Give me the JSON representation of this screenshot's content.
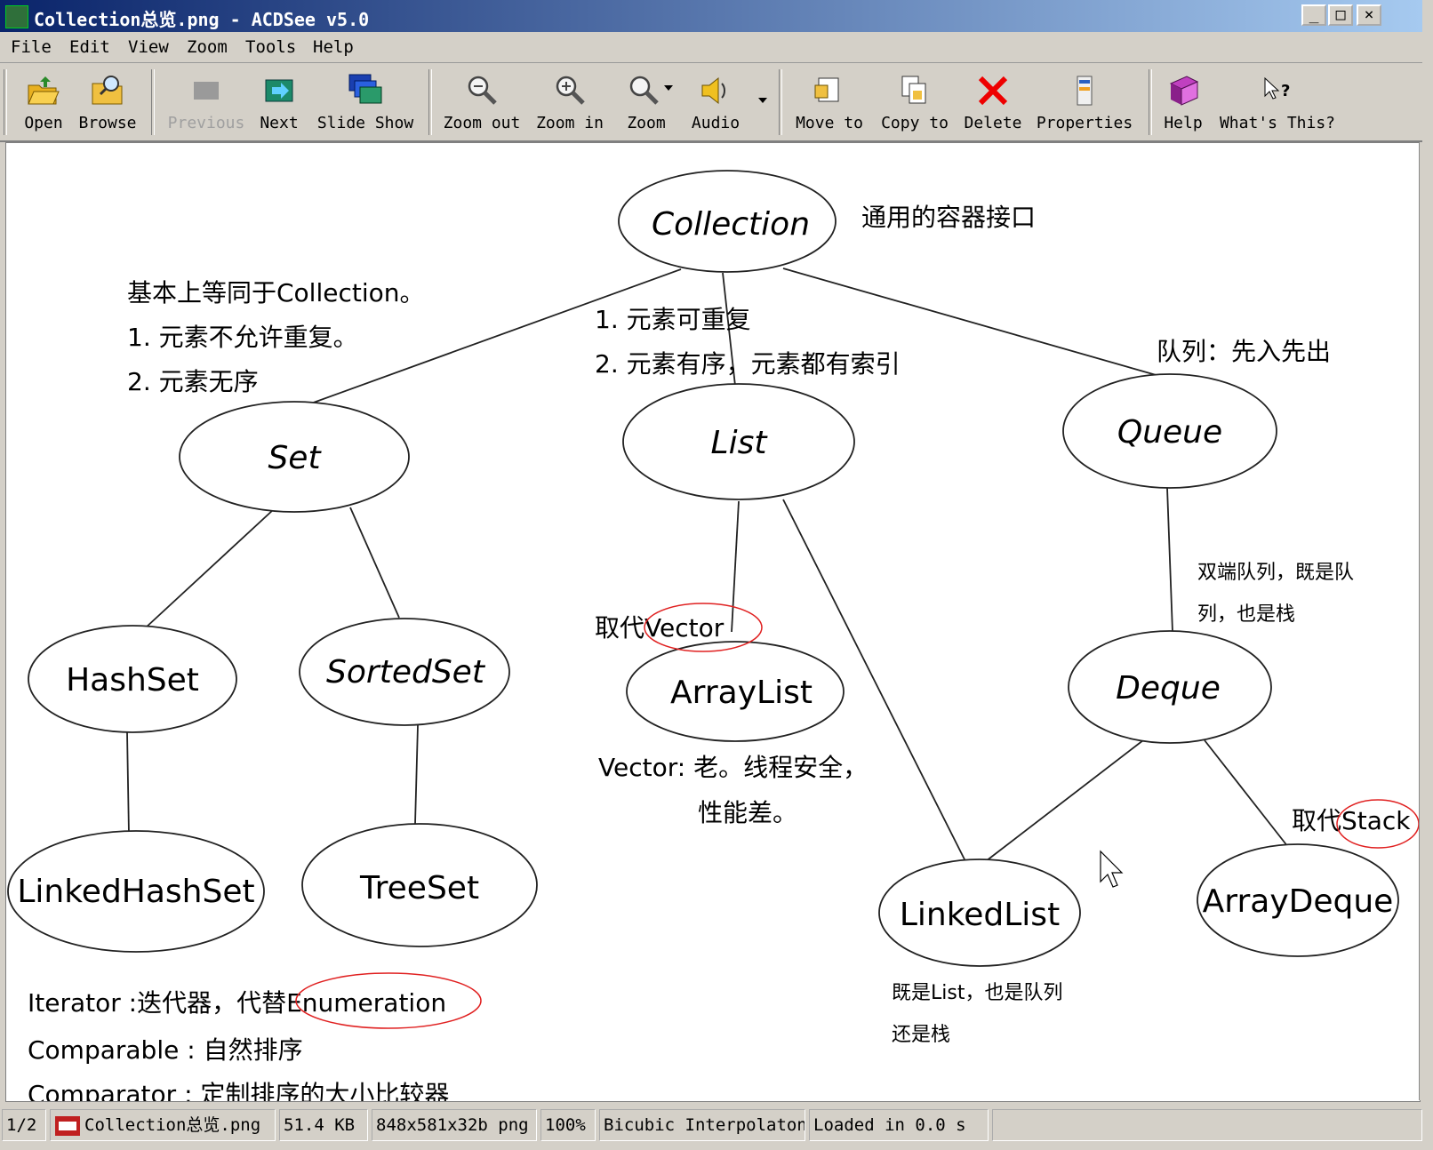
{
  "window": {
    "title": "Collection总览.png - ACDSee v5.0",
    "minimize_glyph": "_",
    "maximize_glyph": "□",
    "close_glyph": "×"
  },
  "menu": [
    "File",
    "Edit",
    "View",
    "Zoom",
    "Tools",
    "Help"
  ],
  "toolbar": [
    {
      "label": "Open",
      "icon": "open-folder-icon",
      "enabled": true
    },
    {
      "label": "Browse",
      "icon": "browse-icon",
      "enabled": true
    },
    {
      "label": "Previous",
      "icon": "previous-icon",
      "enabled": false
    },
    {
      "label": "Next",
      "icon": "next-icon",
      "enabled": true
    },
    {
      "label": "Slide Show",
      "icon": "slideshow-icon",
      "enabled": true
    },
    {
      "label": "Zoom out",
      "icon": "zoom-out-icon",
      "enabled": true
    },
    {
      "label": "Zoom in",
      "icon": "zoom-in-icon",
      "enabled": true
    },
    {
      "label": "Zoom",
      "icon": "zoom-icon",
      "enabled": true
    },
    {
      "label": "Audio",
      "icon": "audio-icon",
      "enabled": true
    },
    {
      "label": "Move to",
      "icon": "move-to-icon",
      "enabled": true
    },
    {
      "label": "Copy to",
      "icon": "copy-to-icon",
      "enabled": true
    },
    {
      "label": "Delete",
      "icon": "delete-icon",
      "enabled": true
    },
    {
      "label": "Properties",
      "icon": "properties-icon",
      "enabled": true
    },
    {
      "label": "Help",
      "icon": "help-book-icon",
      "enabled": true
    },
    {
      "label": "What's This?",
      "icon": "whats-this-icon",
      "enabled": true
    }
  ],
  "diagram": {
    "nodes": {
      "collection": "Collection",
      "set": "Set",
      "list": "List",
      "queue": "Queue",
      "hashset": "HashSet",
      "sortedset": "SortedSet",
      "arraylist": "ArrayList",
      "deque": "Deque",
      "linkedhashset": "LinkedHashSet",
      "treeset": "TreeSet",
      "linkedlist": "LinkedList",
      "arraydeque": "ArrayDeque"
    },
    "notes": {
      "collection_desc": "通用的容器接口",
      "set_line1": "基本上等同于Collection。",
      "set_line2": "1. 元素不允许重复。",
      "set_line3": "2. 元素无序",
      "list_line1": "1. 元素可重复",
      "list_line2": "2. 元素有序，元素都有索引",
      "queue_desc": "队列：先入先出",
      "deque_line1": "双端队列，既是队",
      "deque_line2": "列，也是栈",
      "replace_vector": "取代Vector",
      "vector_line1": "Vector: 老。线程安全，",
      "vector_line2": "性能差。",
      "replace_stack": "取代Stack",
      "linkedlist_line1": "既是List，也是队列",
      "linkedlist_line2": "还是栈",
      "iterator": "Iterator :迭代器，代替Enumeration",
      "comparable": "Comparable : 自然排序",
      "comparator": "Comparator : 定制排序的大小比较器"
    }
  },
  "status": {
    "page": "1/2",
    "filename": "Collection总览.png",
    "filesize": "51.4 KB",
    "dimensions": "848x581x32b png",
    "zoom": "100%",
    "interpolation": "Bicubic Interpolaton",
    "load_time": "Loaded in 0.0 s"
  }
}
